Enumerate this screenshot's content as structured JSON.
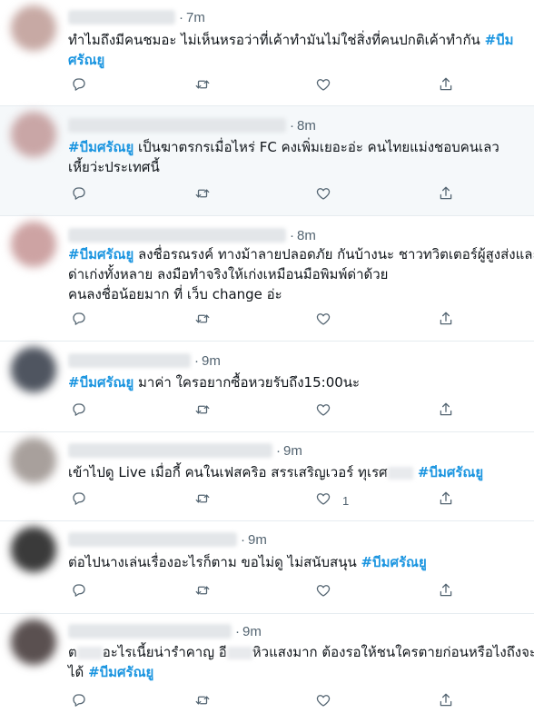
{
  "tweets": [
    {
      "time": "7m",
      "avatar_color": "#c7a9a4",
      "lines": [
        [
          {
            "t": "ทำไมถึงมีคนชมอะ ไม่เห็นหรอว่าที่เค้าทำมันไม่ใช่สิ่งที่คนปกติเค้าทำกัน "
          },
          {
            "t": "#บีม",
            "tag": true
          }
        ],
        [
          {
            "t": "ศรัณยู",
            "tag": true
          }
        ]
      ],
      "like_count": ""
    },
    {
      "time": "8m",
      "avatar_color": "#c9a6a6",
      "lines": [
        [
          {
            "t": "#บีมศรัณยู",
            "tag": true
          },
          {
            "t": " เป็นฆาตรกรเมื่อไหร่ FC คงเพิ่มเยอะอ่ะ คนไทยแม่งชอบคนเลว"
          }
        ],
        [
          {
            "t": "เหี้ยว่ะประเทศนี้"
          }
        ]
      ],
      "like_count": ""
    },
    {
      "time": "8m",
      "avatar_color": "#cda3a3",
      "lines": [
        [
          {
            "t": "#บีมศรัณยู",
            "tag": true
          },
          {
            "t": " ลงชื่อรณรงค์ ทางม้าลายปลอดภัย กันบ้างนะ ชาวทวิตเตอร์ผู้สูงส่งและ"
          }
        ],
        [
          {
            "t": "ด่าเก่งทั้งหลาย ลงมือทำจริงให้เก่งเหมือนมือพิมพ์ด่าด้วย"
          }
        ],
        [
          {
            "t": "คนลงชื่อน้อยมาก ที่ เว็บ change อ่ะ"
          }
        ]
      ],
      "like_count": ""
    },
    {
      "time": "9m",
      "avatar_color": "#4f5560",
      "lines": [
        [
          {
            "t": "#บีมศรัณยู",
            "tag": true
          },
          {
            "t": " มาค่า ใครอยากซื้อหวยรับถึง15:00นะ"
          }
        ]
      ],
      "like_count": ""
    },
    {
      "time": "9m",
      "avatar_color": "#a8a09c",
      "lines": [
        [
          {
            "t": "เข้าไปดู Live เมื่อกี้ คนในเฟสคริอ สรรเสริญเวอร์ ทุเรศ"
          },
          {
            "blur": true
          },
          {
            "t": " #บีมศรัณยู",
            "tag": true
          }
        ]
      ],
      "like_count": "1"
    },
    {
      "time": "9m",
      "avatar_color": "#3a3a3a",
      "lines": [
        [
          {
            "t": "ต่อไปนางเล่นเรื่องอะไรก็ตาม ขอไม่ดู ไม่สนับสนุน "
          },
          {
            "t": "#บีมศรัณยู",
            "tag": true
          }
        ]
      ],
      "like_count": ""
    },
    {
      "time": "9m",
      "avatar_color": "#5a5050",
      "lines": [
        [
          {
            "t": "ต"
          },
          {
            "blur": true
          },
          {
            "t": "อะไรเนี้ยน่ารำคาญ อี"
          },
          {
            "blur": true
          },
          {
            "t": "หิวแสงมาก ต้องรอให้ชนใครตายก่อนหรือไงถึงจะจับ"
          }
        ],
        [
          {
            "t": "ได้ "
          },
          {
            "t": "#บีมศรัณยู",
            "tag": true
          }
        ]
      ],
      "like_count": ""
    }
  ]
}
